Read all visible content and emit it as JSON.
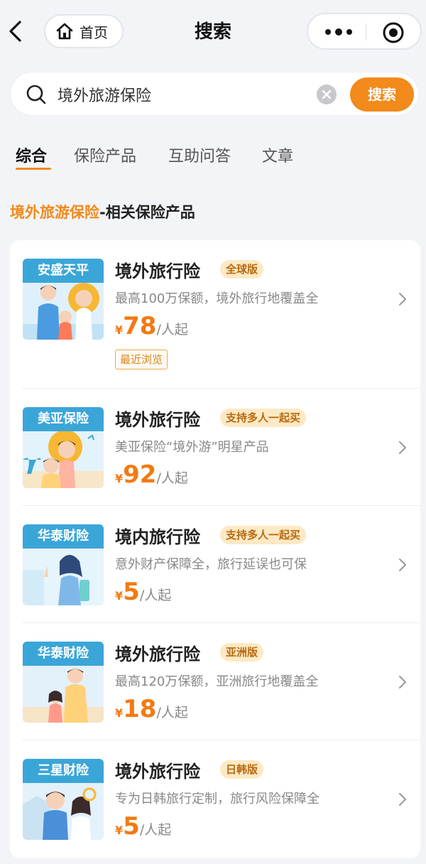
{
  "nav": {
    "home_label": "首页",
    "title": "搜索"
  },
  "search": {
    "query": "境外旅游保险",
    "button_label": "搜索"
  },
  "tabs": [
    {
      "label": "综合",
      "active": true
    },
    {
      "label": "保险产品",
      "active": false
    },
    {
      "label": "互助问答",
      "active": false
    },
    {
      "label": "文章",
      "active": false
    }
  ],
  "section": {
    "highlight": "境外旅游保险",
    "rest": "-相关保险产品"
  },
  "products": [
    {
      "brand": "安盛天平",
      "title": "境外旅行险",
      "tag": "全球版",
      "desc": "最高100万保额，境外旅行地覆盖全",
      "currency": "¥",
      "price": "78",
      "unit": "/人起",
      "badge": "最近浏览"
    },
    {
      "brand": "美亚保险",
      "title": "境外旅行险",
      "tag": "支持多人一起买",
      "desc": "美亚保险“境外游”明星产品",
      "currency": "¥",
      "price": "92",
      "unit": "/人起"
    },
    {
      "brand": "华泰财险",
      "title": "境内旅行险",
      "tag": "支持多人一起买",
      "desc": "意外财产保障全，旅行延误也可保",
      "currency": "¥",
      "price": "5",
      "unit": "/人起"
    },
    {
      "brand": "华泰财险",
      "title": "境外旅行险",
      "tag": "亚洲版",
      "desc": "最高120万保额，亚洲旅行地覆盖全",
      "currency": "¥",
      "price": "18",
      "unit": "/人起"
    },
    {
      "brand": "三星财险",
      "title": "境外旅行险",
      "tag": "日韩版",
      "desc": "专为日韩旅行定制，旅行风险保障全",
      "currency": "¥",
      "price": "5",
      "unit": "/人起"
    }
  ],
  "colors": {
    "accent": "#f28a1c",
    "brand_banner": "#3aa6d8",
    "tag_bg": "#fde9c4"
  }
}
